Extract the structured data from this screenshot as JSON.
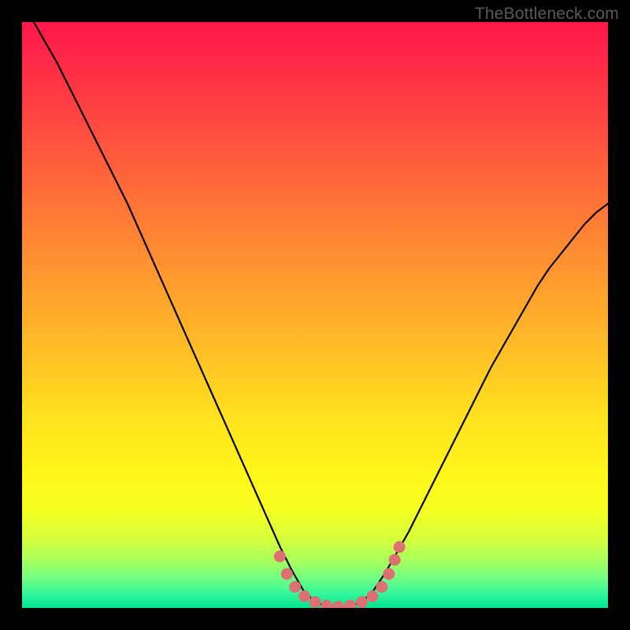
{
  "watermark": "TheBottleneck.com",
  "chart_data": {
    "type": "line",
    "title": "",
    "xlabel": "",
    "ylabel": "",
    "xlim": [
      0,
      100
    ],
    "ylim": [
      0,
      100
    ],
    "grid": false,
    "legend": false,
    "annotations": [],
    "series": [
      {
        "name": "bottleneck-curve",
        "x": [
          0,
          2,
          4,
          6,
          8,
          10,
          12,
          14,
          16,
          18,
          20,
          22,
          24,
          26,
          28,
          30,
          32,
          34,
          36,
          38,
          40,
          42,
          44,
          46,
          48,
          50,
          52,
          54,
          56,
          58,
          60,
          62,
          64,
          66,
          68,
          70,
          72,
          74,
          76,
          78,
          80,
          82,
          84,
          86,
          88,
          90,
          92,
          94,
          96,
          98,
          100
        ],
        "values": [
          103,
          100,
          96.5,
          93,
          89,
          85,
          81,
          77,
          73,
          69,
          64.5,
          60,
          55.5,
          51,
          46.5,
          42,
          37.5,
          33,
          28.5,
          24,
          19.5,
          15,
          10.5,
          6.5,
          3,
          1,
          0.3,
          0.2,
          0.3,
          1,
          3,
          6,
          9.5,
          13,
          17,
          21,
          25,
          29,
          33,
          37,
          41,
          44.5,
          48,
          51.5,
          55,
          58,
          60.5,
          63,
          65.5,
          67.5,
          69
        ]
      }
    ],
    "markers": {
      "name": "salmon-dots",
      "color": "#dd7073",
      "x": [
        44.0,
        45.2,
        46.6,
        48.2,
        50.0,
        52.0,
        54.0,
        56.0,
        58.0,
        59.8,
        61.4,
        62.6,
        63.6,
        64.4
      ],
      "y": [
        8.8,
        5.8,
        3.6,
        2.0,
        1.0,
        0.4,
        0.2,
        0.4,
        1.0,
        2.0,
        3.6,
        5.8,
        8.2,
        10.4
      ]
    },
    "background_gradient": {
      "stops": [
        {
          "pos": 0.0,
          "color": "#ff174a"
        },
        {
          "pos": 0.14,
          "color": "#ff3f43"
        },
        {
          "pos": 0.28,
          "color": "#ff6a3a"
        },
        {
          "pos": 0.42,
          "color": "#ff9530"
        },
        {
          "pos": 0.56,
          "color": "#ffbe26"
        },
        {
          "pos": 0.68,
          "color": "#ffe31e"
        },
        {
          "pos": 0.77,
          "color": "#fff61a"
        },
        {
          "pos": 0.83,
          "color": "#f6ff20"
        },
        {
          "pos": 0.88,
          "color": "#d8ff3a"
        },
        {
          "pos": 0.92,
          "color": "#a8ff5c"
        },
        {
          "pos": 0.95,
          "color": "#6fff83"
        },
        {
          "pos": 0.975,
          "color": "#34f79c"
        },
        {
          "pos": 1.0,
          "color": "#00e58f"
        }
      ]
    }
  }
}
